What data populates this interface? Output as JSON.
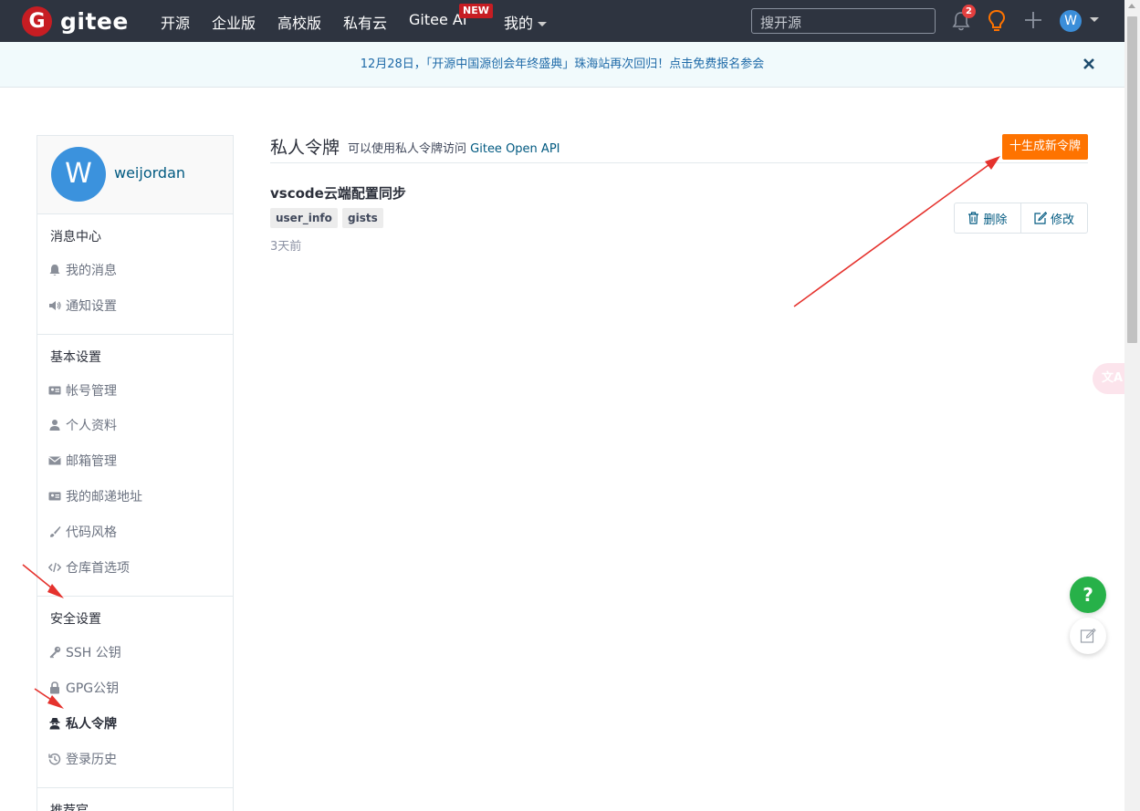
{
  "header": {
    "logo_mark": "G",
    "logo_text": "gitee",
    "nav": [
      "开源",
      "企业版",
      "高校版",
      "私有云",
      "Gitee AI",
      "我的"
    ],
    "new_badge": "NEW",
    "search_placeholder": "搜开源",
    "notification_count": "2",
    "avatar_letter": "W"
  },
  "banner": {
    "text": "12月28日，「开源中国源创会年终盛典」珠海站再次回归！点击免费报名参会"
  },
  "sidebar": {
    "avatar_letter": "W",
    "username": "weijordan",
    "groups": [
      {
        "title": "消息中心",
        "items": [
          {
            "label": "我的消息",
            "icon": "bell-icon"
          },
          {
            "label": "通知设置",
            "icon": "volume-icon"
          }
        ]
      },
      {
        "title": "基本设置",
        "items": [
          {
            "label": "帐号管理",
            "icon": "id-card-icon"
          },
          {
            "label": "个人资料",
            "icon": "user-icon"
          },
          {
            "label": "邮箱管理",
            "icon": "envelope-icon"
          },
          {
            "label": "我的邮递地址",
            "icon": "address-card-icon"
          },
          {
            "label": "代码风格",
            "icon": "brush-icon"
          },
          {
            "label": "仓库首选项",
            "icon": "code-icon"
          }
        ]
      },
      {
        "title": "安全设置",
        "items": [
          {
            "label": "SSH 公钥",
            "icon": "key-icon"
          },
          {
            "label": "GPG公钥",
            "icon": "lock-icon"
          },
          {
            "label": "私人令牌",
            "icon": "user-secret-icon"
          },
          {
            "label": "登录历史",
            "icon": "history-icon"
          }
        ]
      },
      {
        "title": "推荐官",
        "items": []
      }
    ],
    "active_item": "私人令牌"
  },
  "main": {
    "title": "私人令牌",
    "subtitle": "可以使用私人令牌访问",
    "subtitle_link": "Gitee Open API",
    "new_token_button": "十生成新令牌",
    "tokens": [
      {
        "name": "vscode云端配置同步",
        "scopes": [
          "user_info",
          "gists"
        ],
        "time": "3天前",
        "delete_label": "删除",
        "edit_label": "修改"
      }
    ]
  },
  "floating": {
    "translate_label": "文A",
    "help_label": "?"
  },
  "colors": {
    "navbar": "#2e3440",
    "brand_red": "#c71d23",
    "accent_orange": "#fe7300",
    "link_blue": "#005980",
    "help_green": "#27b149",
    "annotation_arrow": "#e5322d"
  }
}
